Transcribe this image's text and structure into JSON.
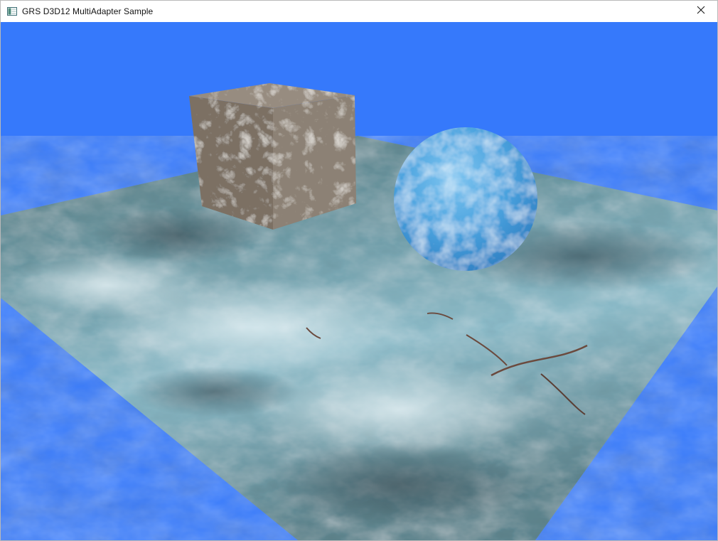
{
  "window": {
    "title": "GRS D3D12 MultiAdapter Sample",
    "icon": "app-window-icon",
    "close_icon": "close-icon"
  },
  "scene": {
    "clear_color": "#3679fb",
    "floor_texture": "cracked-ground-texture",
    "cube_texture": "marble-stone-texture",
    "sphere_texture": "blue-water-texture"
  }
}
